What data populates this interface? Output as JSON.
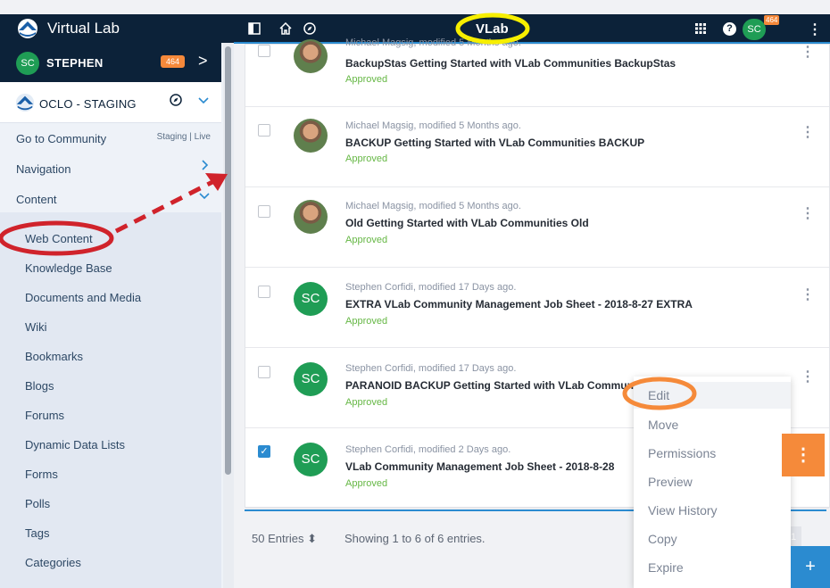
{
  "header": {
    "app_title": "Virtual Lab",
    "center_label": "VLab",
    "avatar_initials": "SC",
    "notification_count": "464",
    "help_label": "?"
  },
  "sidebar": {
    "user_initials": "SC",
    "user_name": "STEPHEN",
    "user_count": "464",
    "site_name": "OCLO - STAGING",
    "go_to_community": "Go to Community",
    "staging_live": "Staging  |  Live",
    "navigation": "Navigation",
    "content": "Content",
    "content_items": [
      "Web Content",
      "Knowledge Base",
      "Documents and Media",
      "Wiki",
      "Bookmarks",
      "Blogs",
      "Forums",
      "Dynamic Data Lists",
      "Forms",
      "Polls",
      "Tags",
      "Categories"
    ]
  },
  "entries": [
    {
      "meta": "Michael Magsig, modified 5 Months ago.",
      "title": "BackupStas Getting Started with VLab Communities BackupStas",
      "status": "Approved",
      "avatar": "photo",
      "checked": false
    },
    {
      "meta": "Michael Magsig, modified 5 Months ago.",
      "title": "BACKUP Getting Started with VLab Communities BACKUP",
      "status": "Approved",
      "avatar": "photo",
      "checked": false
    },
    {
      "meta": "Michael Magsig, modified 5 Months ago.",
      "title": "Old Getting Started with VLab Communities Old",
      "status": "Approved",
      "avatar": "photo",
      "checked": false
    },
    {
      "meta": "Stephen Corfidi, modified 17 Days ago.",
      "title": "EXTRA VLab Community Management Job Sheet - 2018-8-27 EXTRA",
      "status": "Approved",
      "avatar": "SC",
      "checked": false
    },
    {
      "meta": "Stephen Corfidi, modified 17 Days ago.",
      "title": "PARANOID BACKUP Getting Started with VLab Communities",
      "status": "Approved",
      "avatar": "SC",
      "checked": false
    },
    {
      "meta": "Stephen Corfidi, modified 2 Days ago.",
      "title": "VLab Community Management Job Sheet - 2018-8-28",
      "status": "Approved",
      "avatar": "SC",
      "checked": true
    }
  ],
  "footer": {
    "entries_select": "50 Entries",
    "showing": "Showing 1 to 6 of 6 entries.",
    "page": "1"
  },
  "menu": [
    "Edit",
    "Move",
    "Permissions",
    "Preview",
    "View History",
    "Copy",
    "Expire"
  ],
  "colors": {
    "navy": "#0c2239",
    "accent_blue": "#2b8bd0",
    "approved_green": "#65b744",
    "annotation_red": "#d0232b",
    "annotation_orange": "#f58a3a",
    "annotation_yellow": "#f7ef00"
  }
}
